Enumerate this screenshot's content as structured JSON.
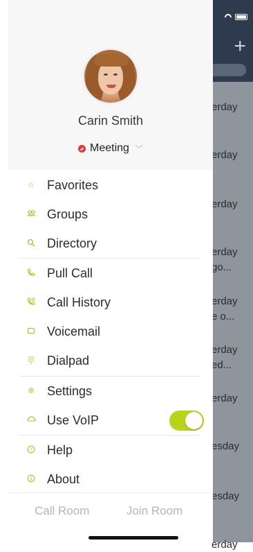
{
  "background": {
    "rows": [
      "erday",
      "erday",
      "erday",
      "erday",
      "go...",
      "erday",
      "e o...",
      "erday",
      "ed...",
      "erday",
      "esday",
      "esday",
      "erday"
    ]
  },
  "profile": {
    "name": "Carin Smith",
    "status": "Meeting"
  },
  "menu": {
    "items": [
      {
        "label": "Favorites",
        "icon": "star-icon"
      },
      {
        "label": "Groups",
        "icon": "groups-icon"
      },
      {
        "label": "Directory",
        "icon": "search-icon"
      },
      {
        "label": "Pull Call",
        "icon": "phone-icon"
      },
      {
        "label": "Call History",
        "icon": "call-history-icon"
      },
      {
        "label": "Voicemail",
        "icon": "voicemail-icon"
      },
      {
        "label": "Dialpad",
        "icon": "dialpad-icon"
      },
      {
        "label": "Settings",
        "icon": "gear-icon"
      },
      {
        "label": "Use VoIP",
        "icon": "cloud-icon"
      },
      {
        "label": "Help",
        "icon": "help-icon"
      },
      {
        "label": "About",
        "icon": "info-icon"
      }
    ]
  },
  "voip": {
    "enabled": true
  },
  "footer": {
    "call_room": "Call Room",
    "join_room": "Join Room"
  },
  "colors": {
    "accent": "#b9d31b",
    "status_busy": "#e53935",
    "header": "#2e3b4e"
  }
}
